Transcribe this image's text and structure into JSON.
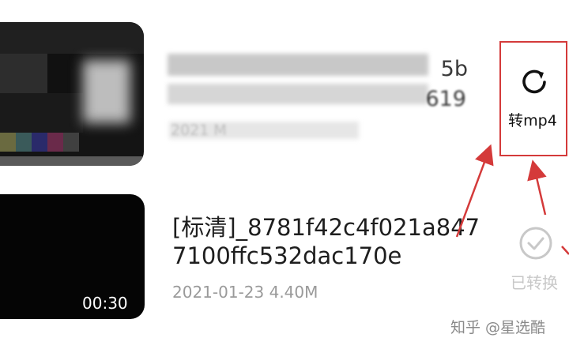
{
  "item1": {
    "title_end_1": "5b",
    "title_end_2": "619",
    "meta_fragment": "2021 M"
  },
  "convert_button": {
    "label": "转mp4",
    "icon": "refresh-icon"
  },
  "item2": {
    "title": "[标清]_8781f42c4f021a8477100ffc532dac170e",
    "date_size": "2021-01-23 4.40M",
    "duration": "00:30"
  },
  "converted_status": {
    "label": "已转换",
    "icon": "check-circle-icon"
  },
  "watermark": "知乎 @星选酷",
  "colors": {
    "highlight_red": "#d43a3a",
    "muted_gray": "#c8c8c8"
  }
}
